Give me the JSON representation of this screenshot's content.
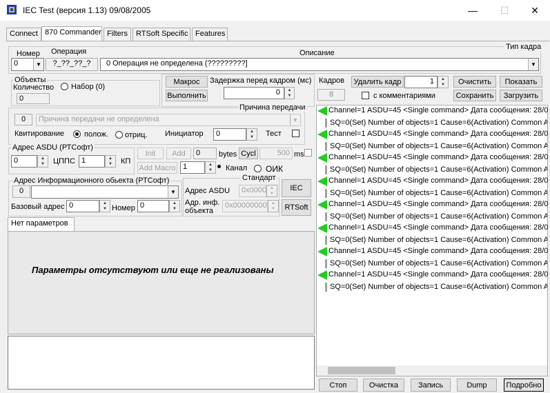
{
  "window": {
    "title": "IEC Test (версия 1.13) 09/08/2005",
    "min": "—",
    "max": "☐",
    "close": "✕"
  },
  "tabs": [
    {
      "label": "Connect"
    },
    {
      "label": "870 Commander"
    },
    {
      "label": "Filters"
    },
    {
      "label": "RTSoft Specific"
    },
    {
      "label": "Features"
    }
  ],
  "frame": {
    "type_label": "Тип кадра",
    "number_label": "Номер",
    "operation_label": "Операция",
    "description_label": "Описание",
    "number_value": "0",
    "operation_value": "?_??_??_?",
    "description_value": "0 Операция не определена (?????????]"
  },
  "objects": {
    "group_label": "Объекты",
    "count_label": "Количество",
    "count_value": "0",
    "set_label": "Набор (0)"
  },
  "macro": {
    "macro_btn": "Макрос",
    "run_btn": "Выполнить",
    "delay_label": "Задержка перед кадром (мс)",
    "delay_value": "0"
  },
  "frames": {
    "label": "Кадров",
    "value": "8",
    "delete_btn": "Удалить кадр",
    "delete_value": "1",
    "clear_btn": "Очистить",
    "show_btn": "Показать",
    "with_comments": "с комментариями",
    "save_btn": "Сохранить",
    "load_btn": "Загрузить"
  },
  "cause": {
    "label": "Причина передачи",
    "code": "0",
    "value": "Причина передачи не определена",
    "ack_label": "Квитирование",
    "pos_label": "полож.",
    "neg_label": "отриц.",
    "initiator_label": "Инициатор",
    "initiator_value": "0",
    "test_label": "Тест"
  },
  "asdu": {
    "label": "Адрес ASDU (РТСофт)",
    "value": "0",
    "cpps_label": "ЦППС",
    "cpps_value": "1",
    "kp_label": "КП",
    "init_btn": "Init",
    "add_btn": "Add",
    "bytes_value": "0",
    "bytes_label": "bytes",
    "cycl_btn": "Cycl",
    "ms_value": "500",
    "ms_label": "ms",
    "add_macro_btn": "Add Macro",
    "channel_value": "1",
    "channel_label": "Канал",
    "oik_label": "ОИК"
  },
  "ioa": {
    "label": "Адрес Информационного обьекта (РТСофт)",
    "code": "0",
    "base_label": "Базовый адрес",
    "base_value": "0",
    "number_label": "Номер",
    "number_value": "0"
  },
  "standard": {
    "label": "Стандарт",
    "asdu_label": "Адрес ASDU",
    "asdu_value": "0x0000",
    "ioa_label_1": "Адр. инф.",
    "ioa_label_2": "объекта",
    "ioa_value": "0x00000000",
    "iec_btn": "IEC",
    "rtsoft_btn": "RTSoft"
  },
  "params": {
    "tab_label": "Нет параметров",
    "message": "Параметры отсутствуют или еще не реализованы"
  },
  "log": {
    "line1": "Channel=1 ASDU=45 <Single command> Дата сообщения: 28/0",
    "line2": "SQ=0(Set) Number of objects=1 Cause=6(Activation) Common ASD"
  },
  "bottom": {
    "stop_btn": "Стоп",
    "clear_btn": "Очистка",
    "record_btn": "Запись",
    "dump_btn": "Dump",
    "detail_btn": "Подробно"
  },
  "colors": {
    "arrow": "#22cc22",
    "icon_blue": "#1a3fb5",
    "icon_yellow": "#f2c200"
  }
}
